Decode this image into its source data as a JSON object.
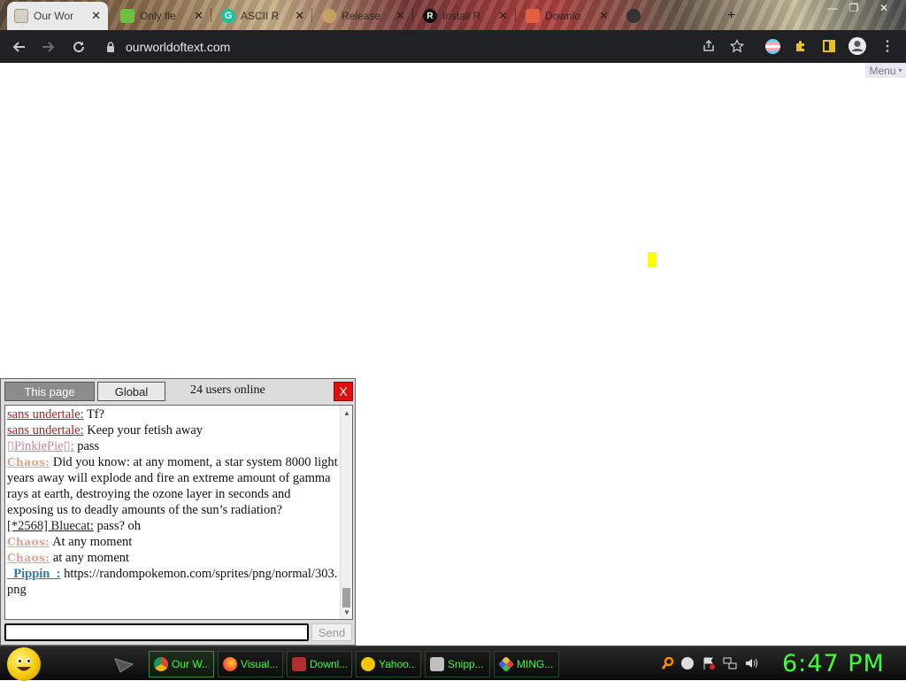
{
  "browser": {
    "tabs": [
      {
        "label": "Our Wor",
        "active": true
      },
      {
        "label": "Only fle",
        "active": false
      },
      {
        "label": "ASCII R",
        "active": false
      },
      {
        "label": "Release",
        "active": false
      },
      {
        "label": "Install R",
        "active": false
      },
      {
        "label": "Downlo",
        "active": false
      }
    ],
    "url": "ourworldoftext.com"
  },
  "page": {
    "menu_label": "Menu",
    "menu_arrow": "▾"
  },
  "chat": {
    "tab_this_page": "This page",
    "tab_global": "Global",
    "users_online": "24 users online",
    "close_label": "X",
    "messages": [
      {
        "nick": "sans undertale:",
        "text": "Tf?"
      },
      {
        "nick": "sans undertale:",
        "text": "Keep your fetish away"
      },
      {
        "nick": "▯PinkiePie▯:",
        "text": "pass"
      },
      {
        "nick": "Chaos:",
        "text": "Did you know: at any moment, a star system 8000 light years away will explode and fire an extreme amount of gamma rays at earth, destroying the ozone layer in seconds and exposing us to deadly amounts of the sun’s radiation?"
      },
      {
        "nick": "[*2568] Bluecat:",
        "text": "pass? oh"
      },
      {
        "nick": "Chaos:",
        "text": "At any moment"
      },
      {
        "nick": "Chaos:",
        "text": "at any moment"
      },
      {
        "nick": "_Pippin_:",
        "text": "https://randompokemon.com/sprites/png/normal/303.png"
      }
    ],
    "input_value": "",
    "send_label": "Send"
  },
  "taskbar": {
    "tasks": [
      {
        "label": "Our W...",
        "icon": "chrome-icon"
      },
      {
        "label": "Visual...",
        "icon": "firefox-icon"
      },
      {
        "label": "Downl...",
        "icon": "download-icon"
      },
      {
        "label": "Yahoo...",
        "icon": "yahoo-icon"
      },
      {
        "label": "Snipp...",
        "icon": "scissors-icon"
      },
      {
        "label": "MING...",
        "icon": "terminal-icon"
      }
    ],
    "clock": "6:47 PM"
  },
  "colors": {
    "accent_green": "#3aff3a",
    "cursor_yellow": "#ffff00",
    "close_red": "#e01010"
  }
}
